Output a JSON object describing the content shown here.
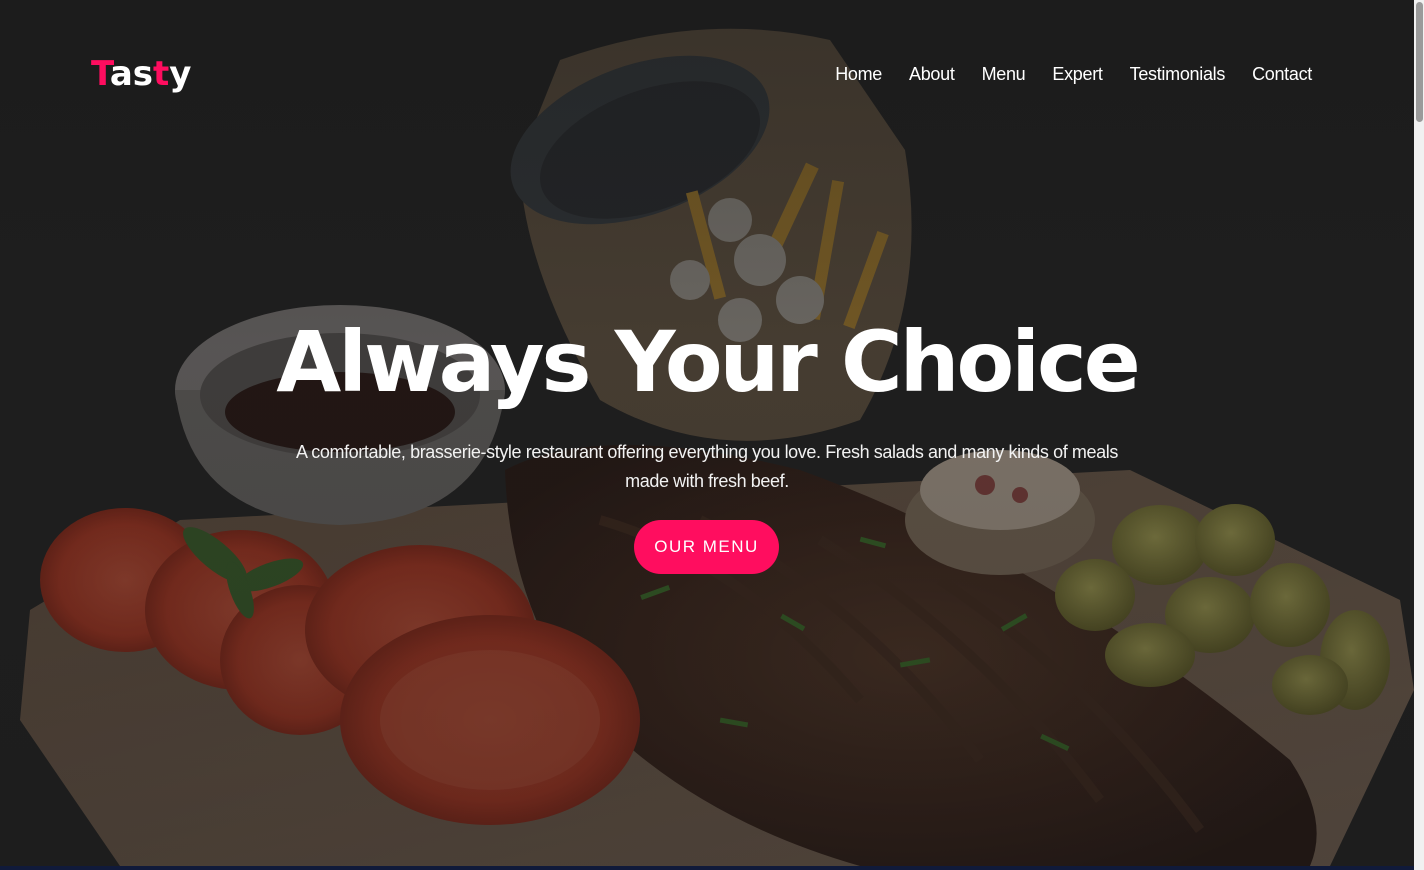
{
  "brand": {
    "logo_parts": [
      {
        "text": "T",
        "highlight": true
      },
      {
        "text": "as",
        "highlight": false
      },
      {
        "text": "t",
        "highlight": true
      },
      {
        "text": "y",
        "highlight": false
      }
    ],
    "accent_color": "#ff0d5f"
  },
  "nav": {
    "items": [
      "Home",
      "About",
      "Menu",
      "Expert",
      "Testimonials",
      "Contact"
    ]
  },
  "hero": {
    "title": "Always Your Choice",
    "subtitle": "A comfortable, brasserie-style restaurant offering everything you love. Fresh salads and many kinds of meals made with fresh beef.",
    "cta_label": "OUR MENU",
    "background_image": "ribs-with-tomatoes-fries-pickles-photo"
  }
}
